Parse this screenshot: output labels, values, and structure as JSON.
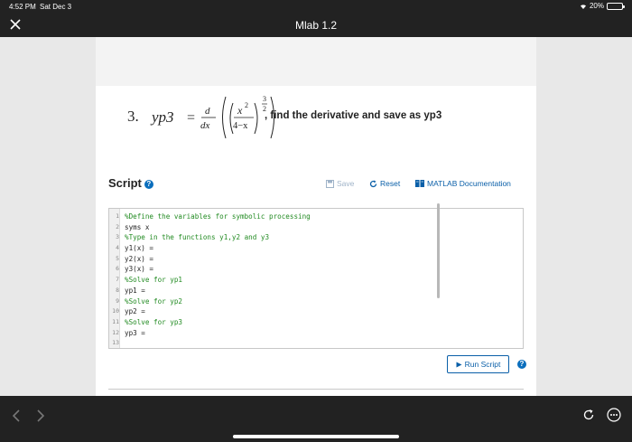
{
  "status_bar": {
    "time": "4:52 PM",
    "date": "Sat Dec 3",
    "battery": "20%",
    "battery_level": 0.2
  },
  "nav": {
    "title": "Mlab 1.2"
  },
  "problem": {
    "number": "3.",
    "lhs": "yp3",
    "d_numer": "d",
    "d_denom": "dx",
    "x_base": "x",
    "x_exp": "2",
    "frac_denom": "4−x",
    "outer_exp_num": "3",
    "outer_exp_den": "2",
    "instruction": ", find the derivative and save as yp3"
  },
  "script": {
    "title": "Script",
    "help_glyph": "?",
    "save_label": "Save",
    "reset_label": "Reset",
    "doc_label": "MATLAB Documentation"
  },
  "editor": {
    "lines": [
      {
        "n": "1",
        "text": "%Define the variables for symbolic processing",
        "comment": true
      },
      {
        "n": "2",
        "text": "syms x",
        "comment": false
      },
      {
        "n": "3",
        "text": "%Type in the functions y1,y2 and y3",
        "comment": true
      },
      {
        "n": "4",
        "text": "y1(x) =",
        "comment": false
      },
      {
        "n": "5",
        "text": "y2(x) =",
        "comment": false
      },
      {
        "n": "6",
        "text": "y3(x) =",
        "comment": false
      },
      {
        "n": "7",
        "text": "%Solve for yp1",
        "comment": true
      },
      {
        "n": "8",
        "text": "yp1 =",
        "comment": false
      },
      {
        "n": "9",
        "text": "%Solve for yp2",
        "comment": true
      },
      {
        "n": "10",
        "text": "yp2 =",
        "comment": false
      },
      {
        "n": "11",
        "text": "%Solve for yp3",
        "comment": true
      },
      {
        "n": "12",
        "text": "yp3 =",
        "comment": false
      },
      {
        "n": "13",
        "text": "",
        "comment": false
      }
    ]
  },
  "run": {
    "label": "Run Script"
  },
  "colors": {
    "accent": "#0a5fa8",
    "comment": "#228b22",
    "chrome": "#222222"
  }
}
